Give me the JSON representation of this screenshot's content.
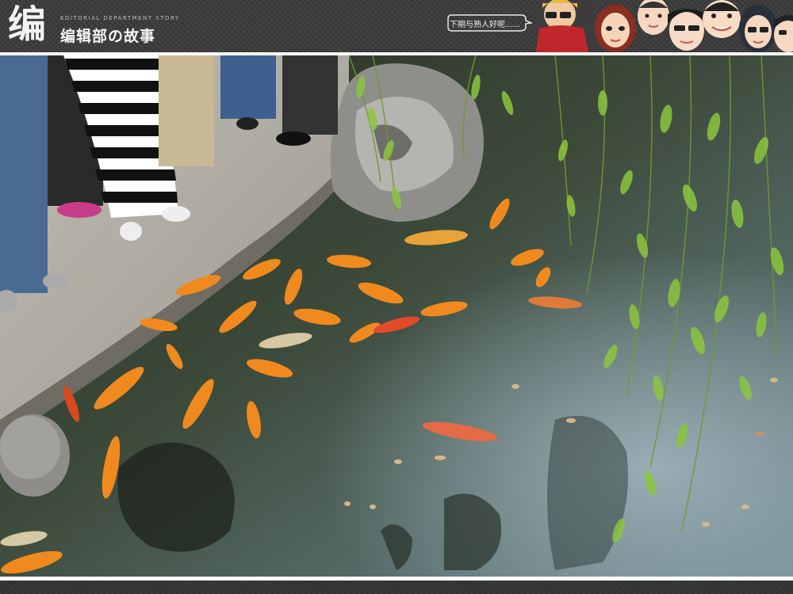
{
  "header": {
    "logo_mark": "编",
    "logo_subtitle": "EDITORIAL DEPARTMENT STORY",
    "logo_title": "编辑部の故事",
    "bubble_text": "下期与熟人好呢......"
  },
  "icons": {
    "logo": "logo-mark-icon",
    "speech_bubble": "speech-bubble-icon",
    "faces": "cartoon-faces-icon"
  },
  "colors": {
    "header_bg": "#3c3c3c",
    "water": "#1f2b22",
    "koi_orange": "#f08a1e",
    "willow_green": "#8cc63f"
  }
}
